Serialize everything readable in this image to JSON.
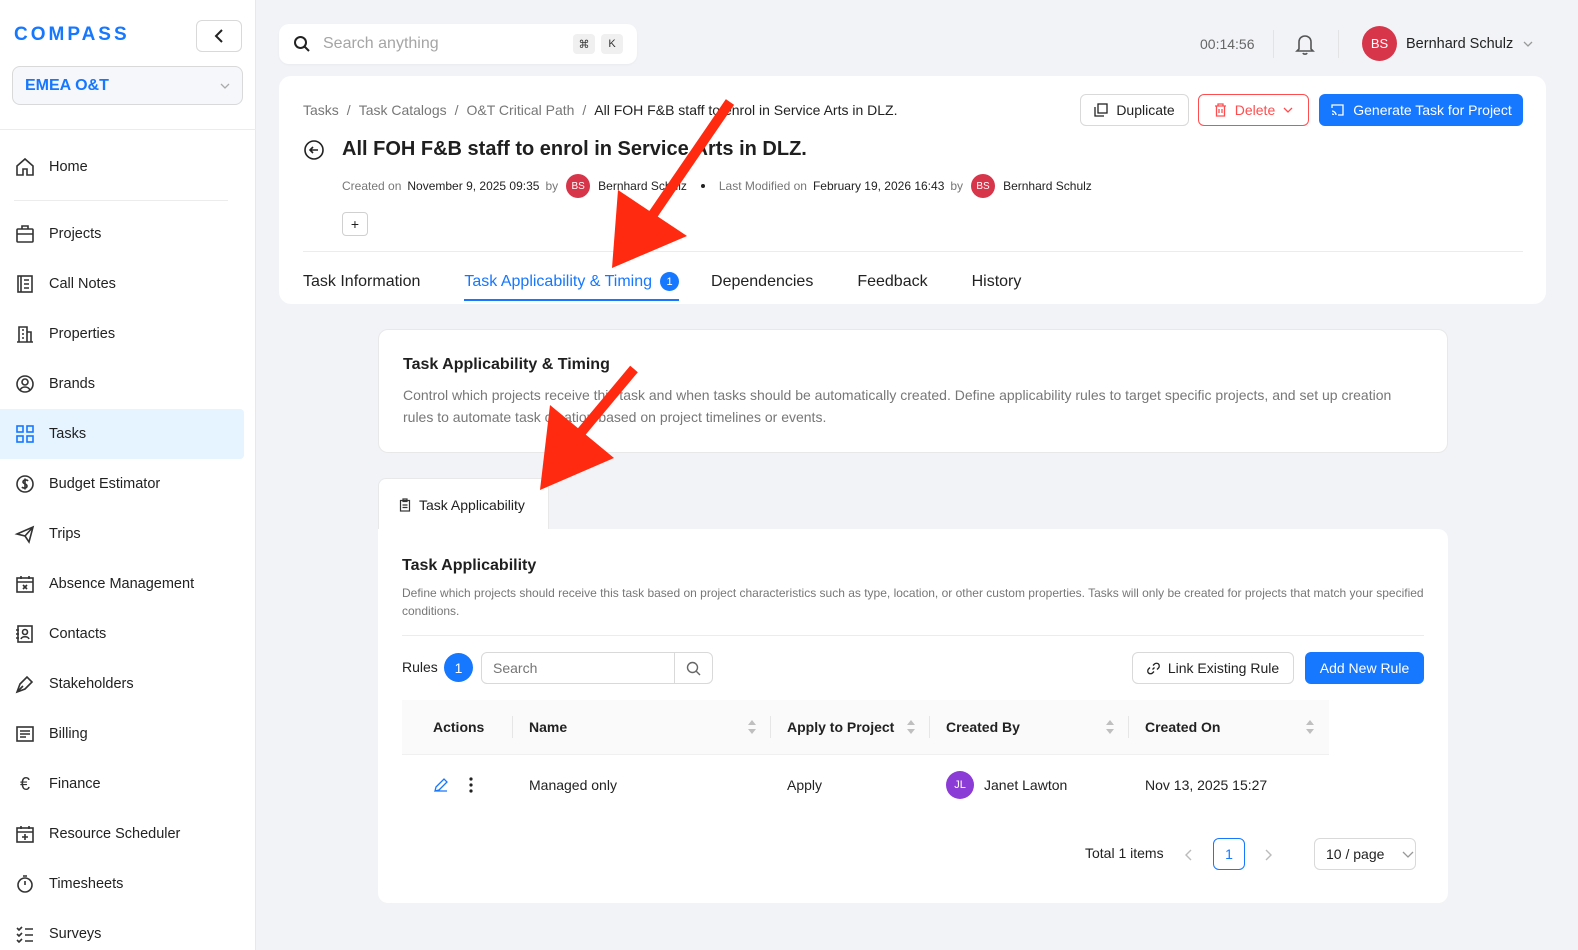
{
  "sidebar": {
    "logo": "COMPASS",
    "org": "EMEA O&T",
    "items": [
      {
        "label": "Home",
        "icon": "home-icon"
      },
      {
        "label": "Projects",
        "icon": "briefcase-icon"
      },
      {
        "label": "Call Notes",
        "icon": "notebook-icon"
      },
      {
        "label": "Properties",
        "icon": "building-icon"
      },
      {
        "label": "Brands",
        "icon": "badge-icon"
      },
      {
        "label": "Tasks",
        "icon": "grid-icon",
        "active": true
      },
      {
        "label": "Budget Estimator",
        "icon": "dollar-icon"
      },
      {
        "label": "Trips",
        "icon": "plane-icon"
      },
      {
        "label": "Absence Management",
        "icon": "calendar-x-icon"
      },
      {
        "label": "Contacts",
        "icon": "contact-icon"
      },
      {
        "label": "Stakeholders",
        "icon": "pen-icon"
      },
      {
        "label": "Billing",
        "icon": "receipt-icon"
      },
      {
        "label": "Finance",
        "icon": "euro-icon"
      },
      {
        "label": "Resource Scheduler",
        "icon": "calendar-plus-icon"
      },
      {
        "label": "Timesheets",
        "icon": "stopwatch-icon"
      },
      {
        "label": "Surveys",
        "icon": "list-check-icon"
      }
    ]
  },
  "topbar": {
    "search_placeholder": "Search anything",
    "kbd_cmd": "⌘",
    "kbd_k": "K",
    "timer": "00:14:56",
    "user_initials": "BS",
    "user_name": "Bernhard Schulz"
  },
  "header": {
    "breadcrumb": [
      "Tasks",
      "Task Catalogs",
      "O&T Critical Path",
      "All FOH F&B staff to enrol in Service Arts in DLZ."
    ],
    "title": "All FOH F&B staff to enrol in Service Arts in DLZ.",
    "created_label": "Created on",
    "created_date": "November 9, 2025 09:35",
    "by": "by",
    "created_by_initials": "BS",
    "created_by": "Bernhard Schulz",
    "modified_label": "Last Modified on",
    "modified_date": "February 19, 2026 16:43",
    "modified_by_initials": "BS",
    "modified_by": "Bernhard Schulz",
    "plus": "+",
    "buttons": {
      "duplicate": "Duplicate",
      "delete": "Delete",
      "generate": "Generate Task for Project"
    },
    "tabs": [
      {
        "label": "Task Information"
      },
      {
        "label": "Task Applicability & Timing",
        "badge": "1",
        "active": true
      },
      {
        "label": "Dependencies"
      },
      {
        "label": "Feedback"
      },
      {
        "label": "History"
      }
    ]
  },
  "intro": {
    "title": "Task Applicability & Timing",
    "description": "Control which projects receive this task and when tasks should be automatically created. Define applicability rules to target specific projects, and set up creation rules to automate task creation based on project timelines or events."
  },
  "applicability": {
    "subtab": "Task Applicability",
    "title": "Task Applicability",
    "description": "Define which projects should receive this task based on project characteristics such as type, location, or other custom properties. Tasks will only be created for projects that match your specified conditions.",
    "rules_label": "Rules",
    "rules_count": "1",
    "search_placeholder": "Search",
    "link_button": "Link Existing Rule",
    "add_button": "Add New Rule",
    "columns": [
      "Actions",
      "Name",
      "Apply to Project",
      "Created By",
      "Created On"
    ],
    "rows": [
      {
        "name": "Managed only",
        "apply": "Apply",
        "created_by_initials": "JL",
        "created_by": "Janet Lawton",
        "created_on": "Nov 13, 2025 15:27"
      }
    ],
    "total": "Total 1 items",
    "page": "1",
    "per_page": "10 / page"
  },
  "colors": {
    "accent": "#1677ff",
    "danger": "#ff4d4f",
    "annotation": "#ff2a10"
  }
}
